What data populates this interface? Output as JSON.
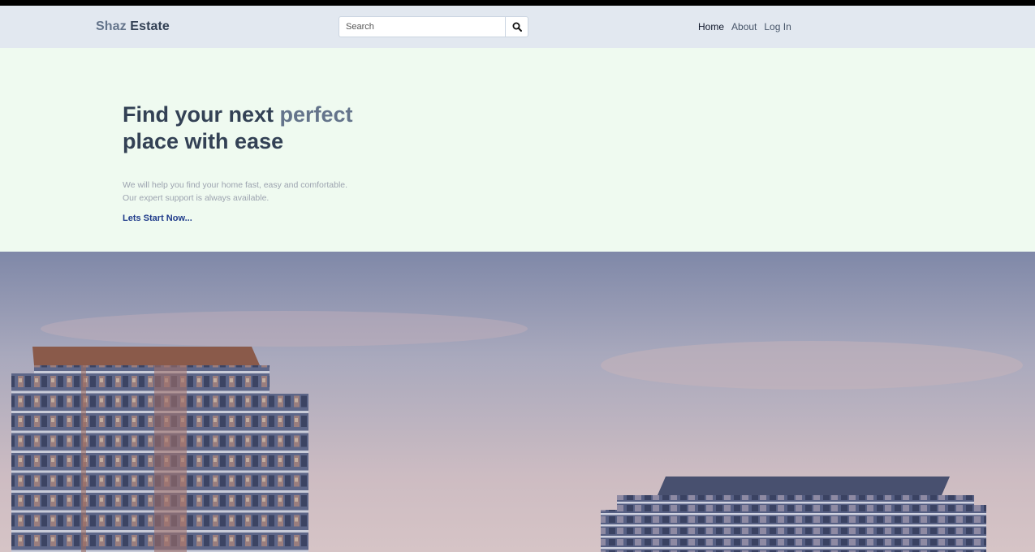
{
  "header": {
    "logo_part1": "Shaz",
    "logo_part2": "Estate",
    "search_placeholder": "Search",
    "search_icon": "magnifier-icon",
    "nav": [
      {
        "label": "Home"
      },
      {
        "label": "About"
      },
      {
        "label": "Log In"
      }
    ]
  },
  "hero": {
    "title_part1": "Find your next ",
    "title_accent": "perfect",
    "title_part2": "place with ease",
    "subtitle_line1": "We will help you find your home fast, easy and comfortable.",
    "subtitle_line2": "Our expert support is always available.",
    "cta": "Lets Start Now..."
  },
  "colors": {
    "header_bg": "#e2e8f0",
    "hero_bg": "#effaf0",
    "brand_dark": "#334155",
    "brand_light": "#64748b",
    "cta": "#1e3a8a"
  }
}
